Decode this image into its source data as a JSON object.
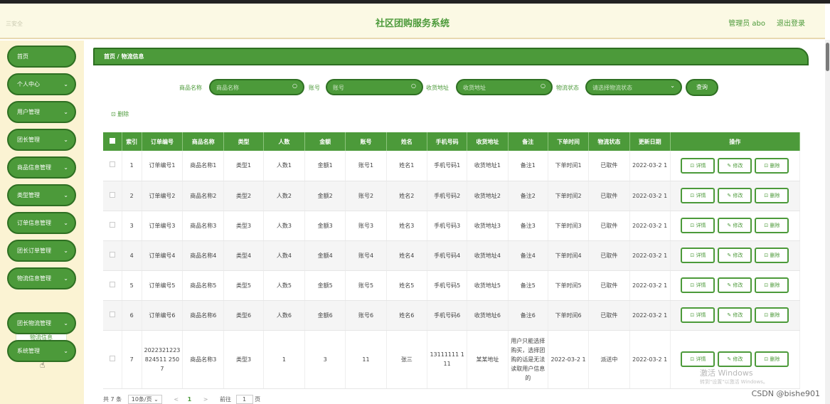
{
  "header": {
    "brand": "三安全",
    "title": "社区团购服务系统",
    "user": "管理员 abo",
    "logout": "退出登录"
  },
  "sidebar": {
    "items": [
      {
        "label": "首页",
        "chevron": false
      },
      {
        "label": "个人中心",
        "chevron": true
      },
      {
        "label": "用户管理",
        "chevron": true
      },
      {
        "label": "团长管理",
        "chevron": true
      },
      {
        "label": "商品信息管理",
        "chevron": true
      },
      {
        "label": "类型管理",
        "chevron": true
      },
      {
        "label": "订单信息管理",
        "chevron": true
      },
      {
        "label": "团长订单管理",
        "chevron": true
      },
      {
        "label": "物流信息管理",
        "chevron": true
      },
      {
        "label": "团长物流管理",
        "chevron": true
      },
      {
        "label": "系统管理",
        "chevron": true
      }
    ],
    "submenu": "物流信息",
    "chevron_glyph": "⌄"
  },
  "breadcrumb": "首页 / 物流信息",
  "search": {
    "product_label": "商品名称",
    "product_placeholder": "商品名称",
    "account_label": "账号",
    "account_placeholder": "账号",
    "address_label": "收货地址",
    "address_placeholder": "收货地址",
    "status_label": "物流状态",
    "status_placeholder": "请选择物流状态",
    "query_button": "查询",
    "search_glyph": "○",
    "dropdown_glyph": "⌄"
  },
  "toolbar": {
    "delete": "⊡ 删除"
  },
  "table": {
    "columns": [
      "索引",
      "订单编号",
      "商品名称",
      "类型",
      "人数",
      "金额",
      "账号",
      "姓名",
      "手机号码",
      "收货地址",
      "备注",
      "下单时间",
      "物流状态",
      "更新日期",
      "操作"
    ],
    "rows": [
      [
        "1",
        "订单编号1",
        "商品名称1",
        "类型1",
        "人数1",
        "金额1",
        "账号1",
        "姓名1",
        "手机号码1",
        "收货地址1",
        "备注1",
        "下单时间1",
        "已取件",
        "2022-03-2 1"
      ],
      [
        "2",
        "订单编号2",
        "商品名称2",
        "类型2",
        "人数2",
        "金额2",
        "账号2",
        "姓名2",
        "手机号码2",
        "收货地址2",
        "备注2",
        "下单时间2",
        "已取件",
        "2022-03-2 1"
      ],
      [
        "3",
        "订单编号3",
        "商品名称3",
        "类型3",
        "人数3",
        "金额3",
        "账号3",
        "姓名3",
        "手机号码3",
        "收货地址3",
        "备注3",
        "下单时间3",
        "已取件",
        "2022-03-2 1"
      ],
      [
        "4",
        "订单编号4",
        "商品名称4",
        "类型4",
        "人数4",
        "金额4",
        "账号4",
        "姓名4",
        "手机号码4",
        "收货地址4",
        "备注4",
        "下单时间4",
        "已取件",
        "2022-03-2 1"
      ],
      [
        "5",
        "订单编号5",
        "商品名称5",
        "类型5",
        "人数5",
        "金额5",
        "账号5",
        "姓名5",
        "手机号码5",
        "收货地址5",
        "备注5",
        "下单时间5",
        "已取件",
        "2022-03-2 1"
      ],
      [
        "6",
        "订单编号6",
        "商品名称6",
        "类型6",
        "人数6",
        "金额6",
        "账号6",
        "姓名6",
        "手机号码6",
        "收货地址6",
        "备注6",
        "下单时间6",
        "已取件",
        "2022-03-2 1"
      ],
      [
        "7",
        "2022321223824511 2507",
        "商品名称3",
        "类型3",
        "1",
        "3",
        "11",
        "张三",
        "13111111 111",
        "某某地址",
        "用户只能选择购买，选择团购的话是无法读取用户信息的",
        "2022-03-2 1",
        "派送中",
        "2022-03-2 1"
      ]
    ],
    "actions": {
      "detail": "⊡ 详情",
      "edit": "✎ 修改",
      "delete": "⊡ 删除"
    }
  },
  "pagination": {
    "total": "共 7 条",
    "page_size": "10条/页 ⌄",
    "prev": "<",
    "current": "1",
    "next": ">",
    "goto": "前往",
    "goto_value": "1",
    "page_suffix": "页"
  },
  "overlay": {
    "watermark": "激活 Windows",
    "watermark_sub": "转到\"设置\"以激活 Windows。",
    "csdn": "CSDN @bishe901"
  },
  "colors": {
    "primary": "#4c9a3a",
    "border": "#2e6f22",
    "sidebar_bg": "#fbf3d3",
    "header_bg": "#fbf9e4"
  }
}
